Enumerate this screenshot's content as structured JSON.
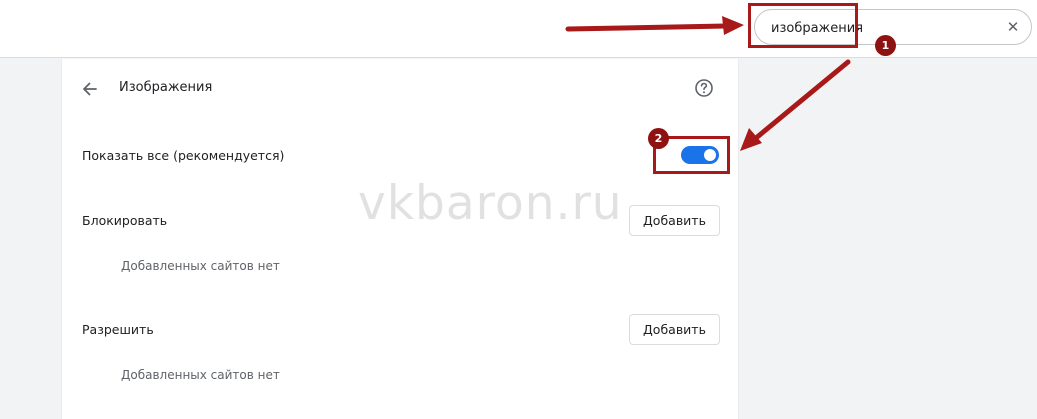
{
  "search": {
    "value": "изображения",
    "clear_symbol": "✕"
  },
  "panel": {
    "title": "Изображения",
    "show_all_label": "Показать все (рекомендуется)",
    "show_all_enabled": true,
    "block": {
      "label": "Блокировать",
      "add_button": "Добавить",
      "empty_note": "Добавленных сайтов нет"
    },
    "allow": {
      "label": "Разрешить",
      "add_button": "Добавить",
      "empty_note": "Добавленных сайтов нет"
    }
  },
  "annotations": {
    "badge_1": "1",
    "badge_2": "2",
    "watermark": "vkbaron.ru"
  },
  "icons": {
    "back": "arrow-back-icon",
    "help": "help-circle-icon",
    "clear": "close-icon"
  },
  "colors": {
    "accent": "#1a73e8",
    "annotation": "#a81919",
    "badge": "#8e1212"
  }
}
